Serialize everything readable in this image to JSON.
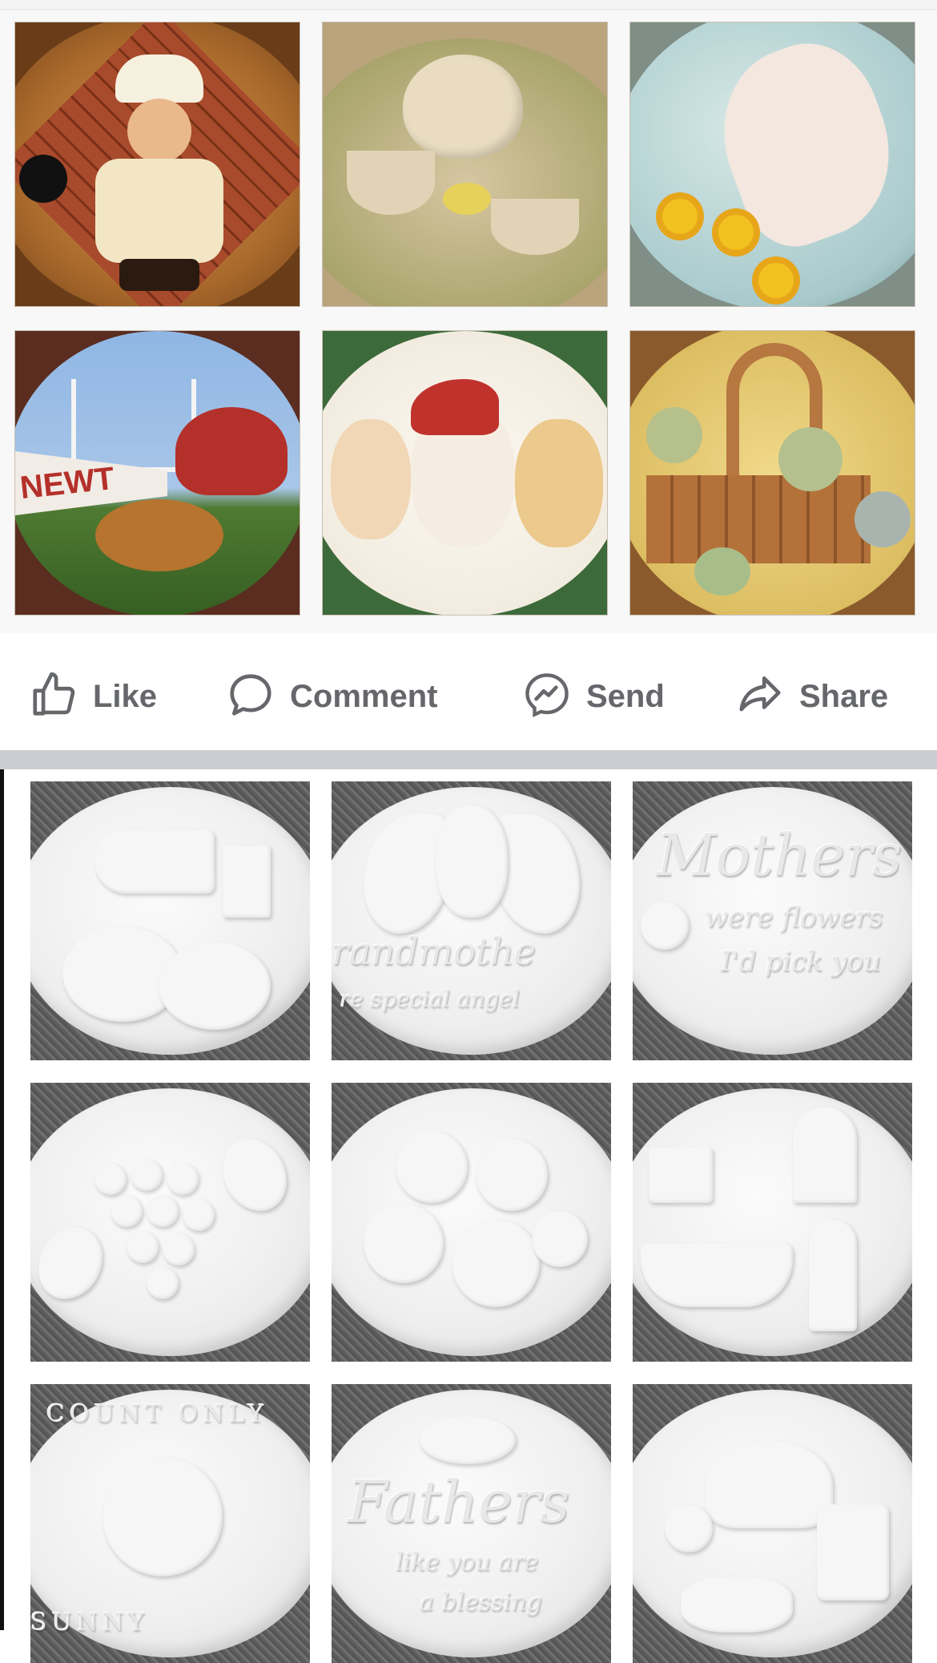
{
  "actions": {
    "like": {
      "label": "Like",
      "icon": "thumbs-up-icon"
    },
    "comment": {
      "label": "Comment",
      "icon": "speech-bubble-icon"
    },
    "send": {
      "label": "Send",
      "icon": "messenger-icon"
    },
    "share": {
      "label": "Share",
      "icon": "share-arrow-icon"
    }
  },
  "colors": {
    "action_text": "#65676b",
    "separator": "#c9ccd1",
    "bisque": "#efefef",
    "backdrop": "#606060"
  },
  "painted_grid": {
    "tiles": [
      {
        "subject": "chef",
        "palette": [
          "#7a4a21",
          "#b04a2e",
          "#f3e8c8"
        ]
      },
      {
        "subject": "tea-set",
        "palette": [
          "#c8b892",
          "#a4a86a",
          "#e8d9bb"
        ]
      },
      {
        "subject": "horse-with-sunflowers",
        "palette": [
          "#b7d3d6",
          "#f2e5dc",
          "#e7b21e"
        ]
      },
      {
        "subject": "football",
        "palette": [
          "#87b1e0",
          "#b8322d",
          "#3f6b2a"
        ]
      },
      {
        "subject": "puppies-christmas",
        "palette": [
          "#f6f0e6",
          "#b5362f",
          "#e0c08e"
        ]
      },
      {
        "subject": "yarn-basket",
        "palette": [
          "#e3c76a",
          "#a4733c",
          "#93a86a"
        ]
      }
    ],
    "banner_text": "NEWT"
  },
  "bisque_grid": {
    "tiles": [
      {
        "subject": "mailbox-pumpkins"
      },
      {
        "subject": "grandmother-angel",
        "text": [
          "randmothe",
          "re special angel"
        ]
      },
      {
        "subject": "mothers",
        "text": [
          "Mothers",
          "were flowers",
          "I'd pick you"
        ]
      },
      {
        "subject": "grapes"
      },
      {
        "subject": "roses"
      },
      {
        "subject": "bathroom"
      },
      {
        "subject": "sun",
        "text": [
          "COUNT ONLY",
          "SUNNY"
        ]
      },
      {
        "subject": "fathers",
        "text": [
          "Fathers",
          "like you are",
          "a blessing"
        ]
      },
      {
        "subject": "baseball"
      }
    ]
  }
}
